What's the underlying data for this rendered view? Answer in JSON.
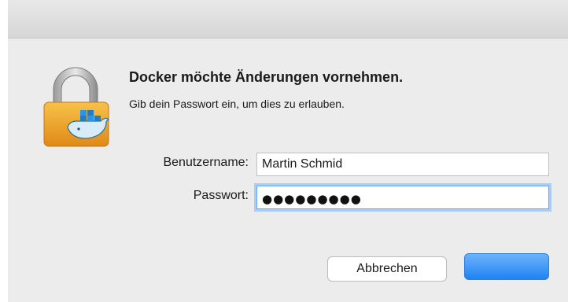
{
  "dialog": {
    "heading": "Docker möchte Änderungen vornehmen.",
    "subtext": "Gib dein Passwort ein, um dies zu erlauben.",
    "icon": "lock-with-docker-whale-icon"
  },
  "form": {
    "username_label": "Benutzername:",
    "username_value": "Martin Schmid",
    "password_label": "Passwort:",
    "password_masked": "●●●●●●●●●"
  },
  "buttons": {
    "cancel_label": "Abbrechen",
    "ok_label": ""
  },
  "colors": {
    "accent": "#1f83f2",
    "dialog_bg": "#ececec",
    "lock_gold": "#f2a42a"
  }
}
